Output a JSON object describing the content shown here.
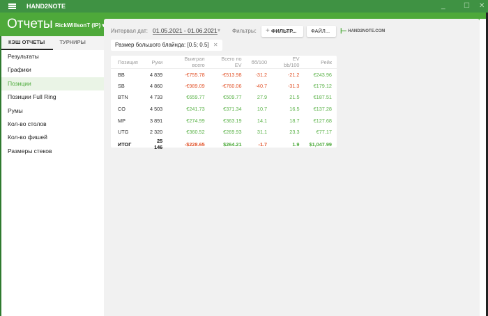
{
  "app": {
    "name": "HAND2NOTE",
    "title": "Отчеты",
    "user": "RickWillsonT (IP)"
  },
  "window": {
    "minimize": "_",
    "maximize": "☐",
    "close": "✕"
  },
  "sidebar": {
    "tabs": [
      "КЭШ ОТЧЕТЫ",
      "ТУРНИРЫ"
    ],
    "active_tab": "КЭШ ОТЧЕТЫ",
    "items": [
      {
        "label": "Результаты"
      },
      {
        "label": "Графики"
      },
      {
        "label": "Позиции",
        "selected": true
      },
      {
        "label": "Позиции Full Ring"
      },
      {
        "label": "Румы"
      },
      {
        "label": "Кол-во столов"
      },
      {
        "label": "Кол-во фишей"
      },
      {
        "label": "Размеры стеков"
      }
    ]
  },
  "toolbar": {
    "date_label": "Интервал дат:",
    "date_value": "01.05.2021 - 01.06.2021",
    "filters_label": "Фильтры:",
    "filter_button": "ФИЛЬТР...",
    "file_button": "ФАЙЛ...",
    "logo": "HAND2NOTE.COM"
  },
  "chip": {
    "label": "Размер большого блайнда: [0.5; 0.5]"
  },
  "colors": {
    "accent": "#4ea93a",
    "negative": "#e2542b",
    "positive": "#5cb34a"
  },
  "table": {
    "columns": [
      "Позиция",
      "Руки",
      "Выиграл всего",
      "Всего по EV",
      "бб/100",
      "EV bb/100",
      "Рейк"
    ],
    "rows": [
      [
        "BB",
        "4 839",
        "-€755.78",
        "-€513.98",
        "-31.2",
        "-21.2",
        "€243.96"
      ],
      [
        "SB",
        "4 860",
        "-€989.09",
        "-€760.06",
        "-40.7",
        "-31.3",
        "€179.12"
      ],
      [
        "BTN",
        "4 733",
        "€659.77",
        "€509.77",
        "27.9",
        "21.5",
        "€187.51"
      ],
      [
        "CO",
        "4 503",
        "€241.73",
        "€371.34",
        "10.7",
        "16.5",
        "€137.28"
      ],
      [
        "MP",
        "3 891",
        "€274.99",
        "€363.19",
        "14.1",
        "18.7",
        "€127.68"
      ],
      [
        "UTG",
        "2 320",
        "€360.52",
        "€269.93",
        "31.1",
        "23.3",
        "€77.17"
      ]
    ],
    "total": [
      "ИТОГ",
      "25 146",
      "-$228.65",
      "$264.21",
      "-1.7",
      "1.9",
      "$1,047.99"
    ]
  }
}
